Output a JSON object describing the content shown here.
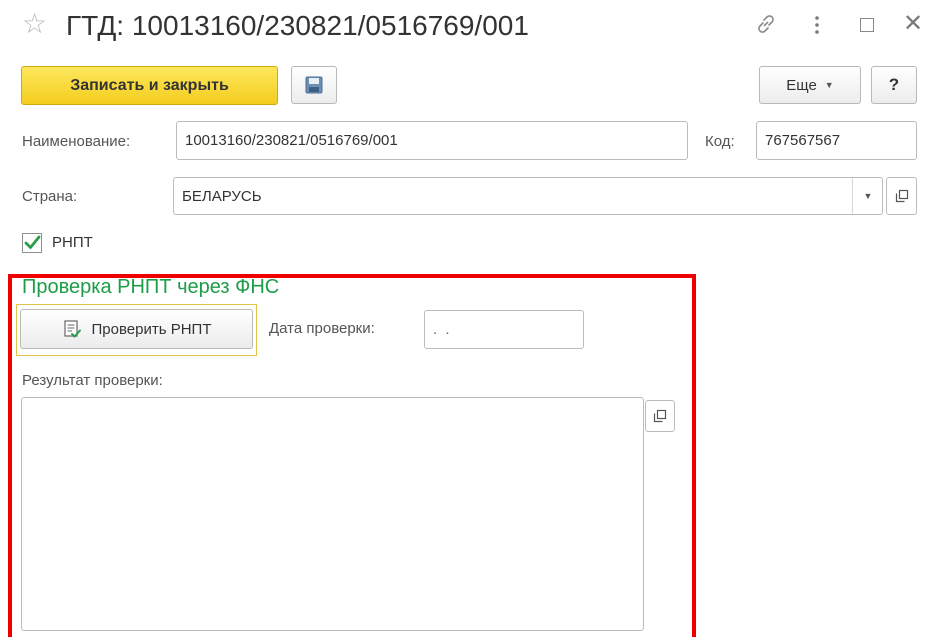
{
  "window": {
    "title": "ГТД: 10013160/230821/0516769/001"
  },
  "toolbar": {
    "save_close_label": "Записать и закрыть",
    "more_label": "Еще",
    "help_label": "?"
  },
  "form": {
    "name_label": "Наименование:",
    "name_value": "10013160/230821/0516769/001",
    "code_label": "Код:",
    "code_value": "767567567",
    "country_label": "Страна:",
    "country_value": "БЕЛАРУСЬ",
    "rnpt_label": "РНПТ",
    "rnpt_checked": true
  },
  "rnpt_check": {
    "group_title": "Проверка РНПТ через ФНС",
    "check_button_label": "Проверить РНПТ",
    "date_label": "Дата проверки:",
    "date_value": " .  . ",
    "result_label": "Результат проверки:",
    "result_value": ""
  },
  "colors": {
    "primary_button": "#f4cd1f",
    "group_title": "#1d9d48",
    "highlight_frame": "#ee0000",
    "checkmark": "#2a9d49"
  }
}
